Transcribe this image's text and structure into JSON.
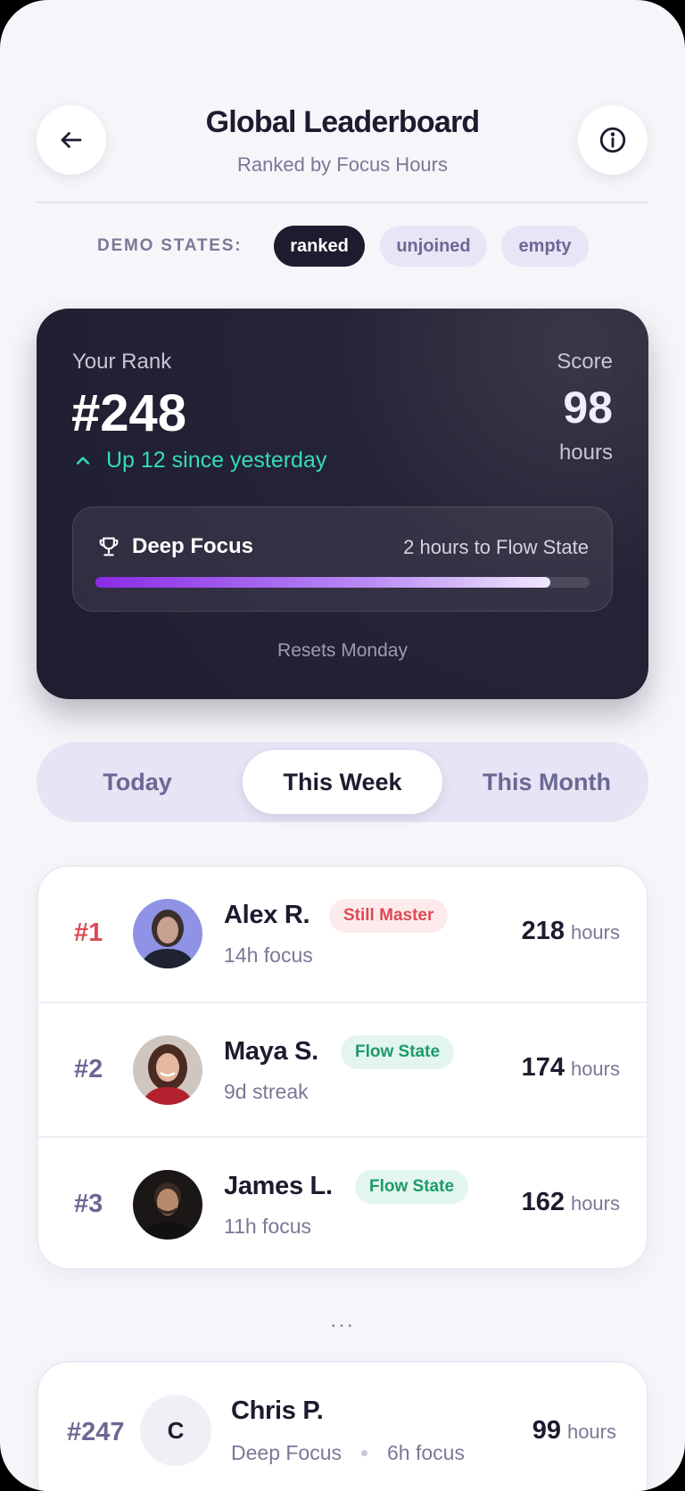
{
  "header": {
    "title": "Global Leaderboard",
    "subtitle": "Ranked by Focus Hours",
    "back_icon": "arrow-left-icon",
    "info_icon": "info-icon"
  },
  "demo": {
    "label": "DEMO STATES:",
    "states": [
      "ranked",
      "unjoined",
      "empty"
    ],
    "active": "ranked"
  },
  "rank_card": {
    "rank_label": "Your Rank",
    "rank": "#248",
    "change": "Up 12 since yesterday",
    "score_label": "Score",
    "score": "98",
    "score_unit": "hours",
    "tier_name": "Deep Focus",
    "next_tier_text": "2 hours to Flow State",
    "progress_fraction": 0.92,
    "resets": "Resets Monday",
    "accent_color": "#34dcb6"
  },
  "tabs": {
    "items": [
      "Today",
      "This Week",
      "This Month"
    ],
    "active": "This Week"
  },
  "leaders": [
    {
      "position": "#1",
      "name": "Alex R.",
      "badge": "Still Master",
      "meta": "14h focus",
      "score": "218",
      "unit": "hours"
    },
    {
      "position": "#2",
      "name": "Maya S.",
      "badge": "Flow State",
      "meta": "9d streak",
      "score": "174",
      "unit": "hours"
    },
    {
      "position": "#3",
      "name": "James L.",
      "badge": "Flow State",
      "meta": "11h focus",
      "score": "162",
      "unit": "hours"
    }
  ],
  "ellipsis": "...",
  "me": {
    "position": "#247",
    "initial": "C",
    "name": "Chris P.",
    "tier": "Deep Focus",
    "meta": "6h focus",
    "score": "99",
    "unit": "hours"
  }
}
